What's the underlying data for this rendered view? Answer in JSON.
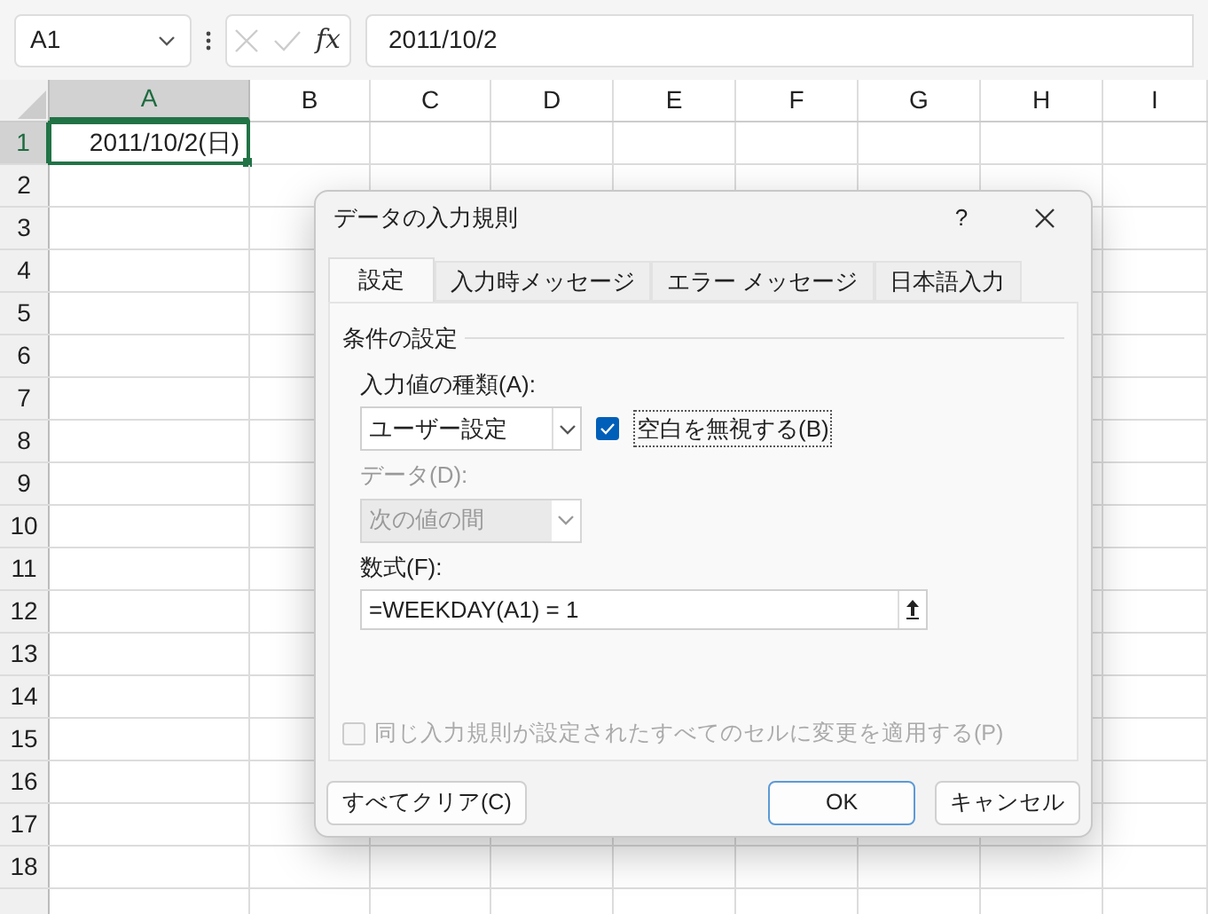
{
  "formula_bar": {
    "name_box": "A1",
    "fx_label": "fx",
    "formula": "2011/10/2"
  },
  "columns": [
    {
      "label": "A",
      "selected": true
    },
    {
      "label": "B",
      "selected": false
    },
    {
      "label": "C",
      "selected": false
    },
    {
      "label": "D",
      "selected": false
    },
    {
      "label": "E",
      "selected": false
    },
    {
      "label": "F",
      "selected": false
    },
    {
      "label": "G",
      "selected": false
    },
    {
      "label": "H",
      "selected": false
    },
    {
      "label": "I",
      "selected": false
    }
  ],
  "rows": [
    {
      "label": "1",
      "selected": true,
      "cell_a": "2011/10/2(日)"
    },
    {
      "label": "2",
      "selected": false
    },
    {
      "label": "3",
      "selected": false
    },
    {
      "label": "4",
      "selected": false
    },
    {
      "label": "5",
      "selected": false
    },
    {
      "label": "6",
      "selected": false
    },
    {
      "label": "7",
      "selected": false
    },
    {
      "label": "8",
      "selected": false
    },
    {
      "label": "9",
      "selected": false
    },
    {
      "label": "10",
      "selected": false
    },
    {
      "label": "11",
      "selected": false
    },
    {
      "label": "12",
      "selected": false
    },
    {
      "label": "13",
      "selected": false
    },
    {
      "label": "14",
      "selected": false
    },
    {
      "label": "15",
      "selected": false
    },
    {
      "label": "16",
      "selected": false
    },
    {
      "label": "17",
      "selected": false
    },
    {
      "label": "18",
      "selected": false
    }
  ],
  "dialog": {
    "title": "データの入力規則",
    "help": "?",
    "tabs": [
      {
        "label": "設定",
        "selected": true
      },
      {
        "label": "入力時メッセージ",
        "selected": false
      },
      {
        "label": "エラー メッセージ",
        "selected": false
      },
      {
        "label": "日本語入力",
        "selected": false
      }
    ],
    "group_label": "条件の設定",
    "allow_label": "入力値の種類(A):",
    "allow_value": "ユーザー設定",
    "ignore_blank": {
      "label": "空白を無視する(B)",
      "checked": true
    },
    "data_label": "データ(D):",
    "data_value": "次の値の間",
    "data_disabled": true,
    "formula_label": "数式(F):",
    "formula_value": "=WEEKDAY(A1) = 1",
    "apply_all": {
      "label": "同じ入力規則が設定されたすべてのセルに変更を適用する(P)",
      "checked": false,
      "disabled": true
    },
    "buttons": {
      "clear": "すべてクリア(C)",
      "ok": "OK",
      "cancel": "キャンセル"
    }
  }
}
